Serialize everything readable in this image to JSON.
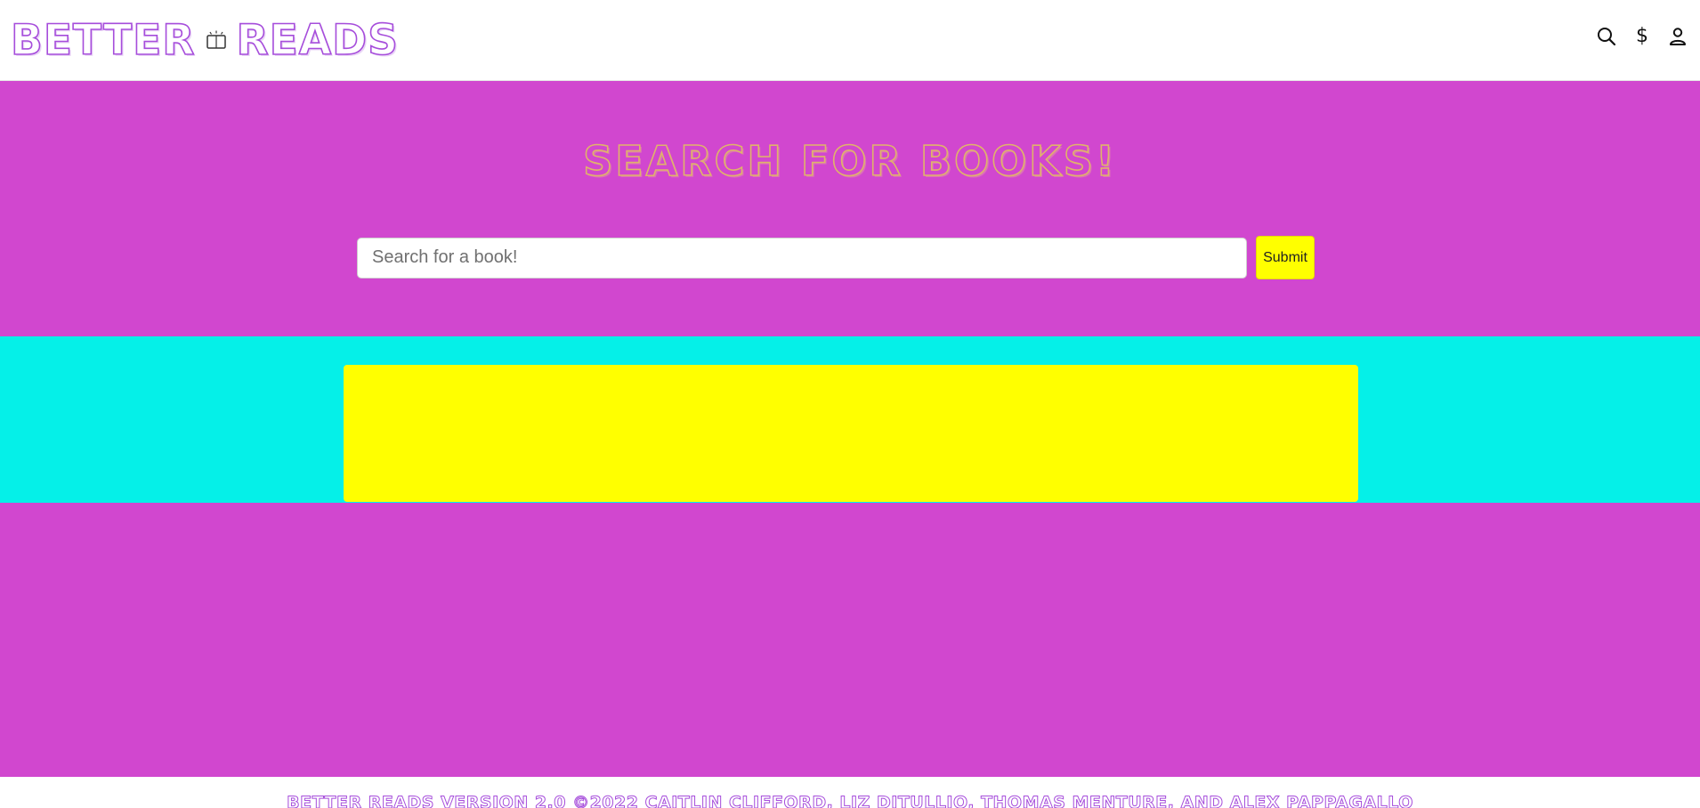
{
  "header": {
    "brand_left": "BETTER",
    "brand_right": "READS",
    "brand_icon": "open-book-icon",
    "icons": [
      "search-icon",
      "dollar-icon",
      "user-icon"
    ],
    "dollar_glyph": "$"
  },
  "hero": {
    "title": "SEARCH FOR BOOKS!",
    "search_placeholder": "Search for a book!",
    "search_value": "",
    "submit_label": "Submit"
  },
  "footer": {
    "text": "BETTER READS VERSION 2.0 ©2022 CAITLIN CLIFFORD, LIZ DITULLIO, THOMAS MENTURE, AND ALEX PAPPAGALLO"
  },
  "colors": {
    "magenta": "#d147cf",
    "cyan": "#05f0e8",
    "yellow": "#ffff00",
    "brand_purple": "#a64ddb",
    "title_gold": "#e0b36a"
  }
}
